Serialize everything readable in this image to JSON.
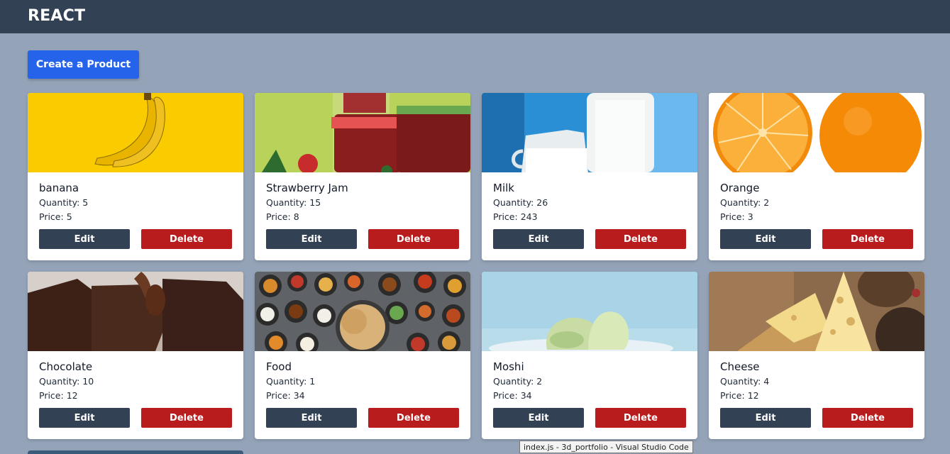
{
  "navbar": {
    "brand": "REACT"
  },
  "actions": {
    "create_label": "Create a Product"
  },
  "labels": {
    "quantity": "Quantity: ",
    "price": "Price: ",
    "edit": "Edit",
    "delete": "Delete"
  },
  "products": [
    {
      "name": "banana",
      "quantity": "5",
      "price": "5",
      "image": "banana"
    },
    {
      "name": "Strawberry Jam",
      "quantity": "15",
      "price": "8",
      "image": "strawberry-jam"
    },
    {
      "name": "Milk",
      "quantity": "26",
      "price": "243",
      "image": "milk"
    },
    {
      "name": "Orange",
      "quantity": "2",
      "price": "3",
      "image": "orange"
    },
    {
      "name": "Chocolate",
      "quantity": "10",
      "price": "12",
      "image": "chocolate"
    },
    {
      "name": "Food",
      "quantity": "1",
      "price": "34",
      "image": "food"
    },
    {
      "name": "Moshi",
      "quantity": "2",
      "price": "34",
      "image": "moshi"
    },
    {
      "name": "Cheese",
      "quantity": "4",
      "price": "12",
      "image": "cheese"
    }
  ],
  "tooltip": {
    "text": "index.js - 3d_portfolio - Visual Studio Code"
  },
  "colors": {
    "navbar": "#334155",
    "background": "#94a3b8",
    "primary": "#2563eb",
    "edit": "#334155",
    "delete": "#b91c1c"
  }
}
